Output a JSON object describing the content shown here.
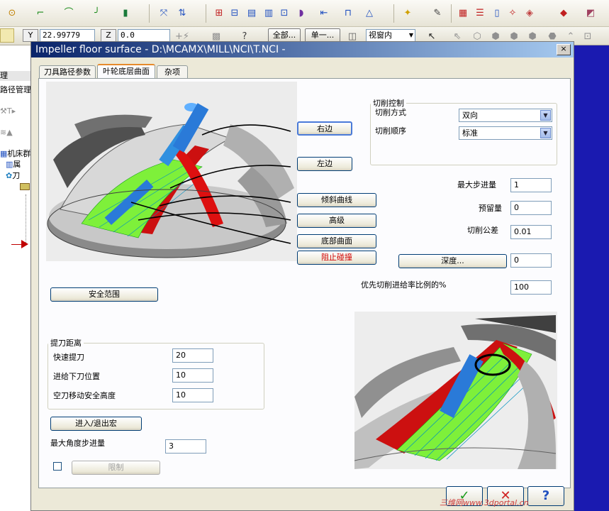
{
  "toolbar2": {
    "y_label": "Y",
    "y_value": "22.99779",
    "z_label": "Z",
    "z_value": "0.0",
    "btn_all": "全部...",
    "btn_single": "单一...",
    "view_select": "视窗内"
  },
  "left_panel": {
    "items": [
      "理",
      "路径管理",
      "机床群",
      "属",
      "刀"
    ]
  },
  "dialog": {
    "title": "Impeller floor surface - D:\\MCAMX\\MILL\\NCI\\T.NCI -",
    "close_label": "×",
    "tabs": [
      "刀具路径参数",
      "叶轮底层曲面",
      "杂项"
    ],
    "buttons": {
      "right_edge": "右边",
      "left_edge": "左边",
      "tilt_curve": "倾斜曲线",
      "advanced": "高级",
      "floor_surface": "底部曲面",
      "prevent_collision": "阻止碰撞",
      "safety_zone": "安全范围",
      "depth": "深度...",
      "entry_exit_macro": "进入/退出宏",
      "limit": "限制"
    },
    "cut_control": {
      "legend": "切削控制",
      "cut_method_label": "切削方式",
      "cut_method_value": "双向",
      "cut_order_label": "切削顺序",
      "cut_order_value": "标准"
    },
    "params": {
      "max_stepover_label": "最大步进量",
      "max_stepover_value": "1",
      "stock_label": "预留量",
      "stock_value": "0",
      "tolerance_label": "切削公差",
      "tolerance_value": "0.01",
      "depth_value": "0",
      "feed_ratio_label": "优先切削进给率比例的%",
      "feed_ratio_value": "100"
    },
    "retract": {
      "legend": "提刀距离",
      "rapid_label": "快速提刀",
      "rapid_value": "20",
      "feed_plunge_label": "进给下刀位置",
      "feed_plunge_value": "10",
      "air_move_label": "空刀移动安全高度",
      "air_move_value": "10"
    },
    "max_angle_step_label": "最大角度步进量",
    "max_angle_step_value": "3",
    "ok_label": "✓",
    "cancel_label": "✕",
    "help_label": "?"
  },
  "watermark": "三维网www.3dportal.cn",
  "colors": {
    "title_start": "#0a246a",
    "title_end": "#a6caf0",
    "side_blue": "#1a1ab0",
    "prevent_collision_text": "#d00000",
    "ok_green": "#1a9a1a",
    "cancel_red": "#d02020"
  }
}
